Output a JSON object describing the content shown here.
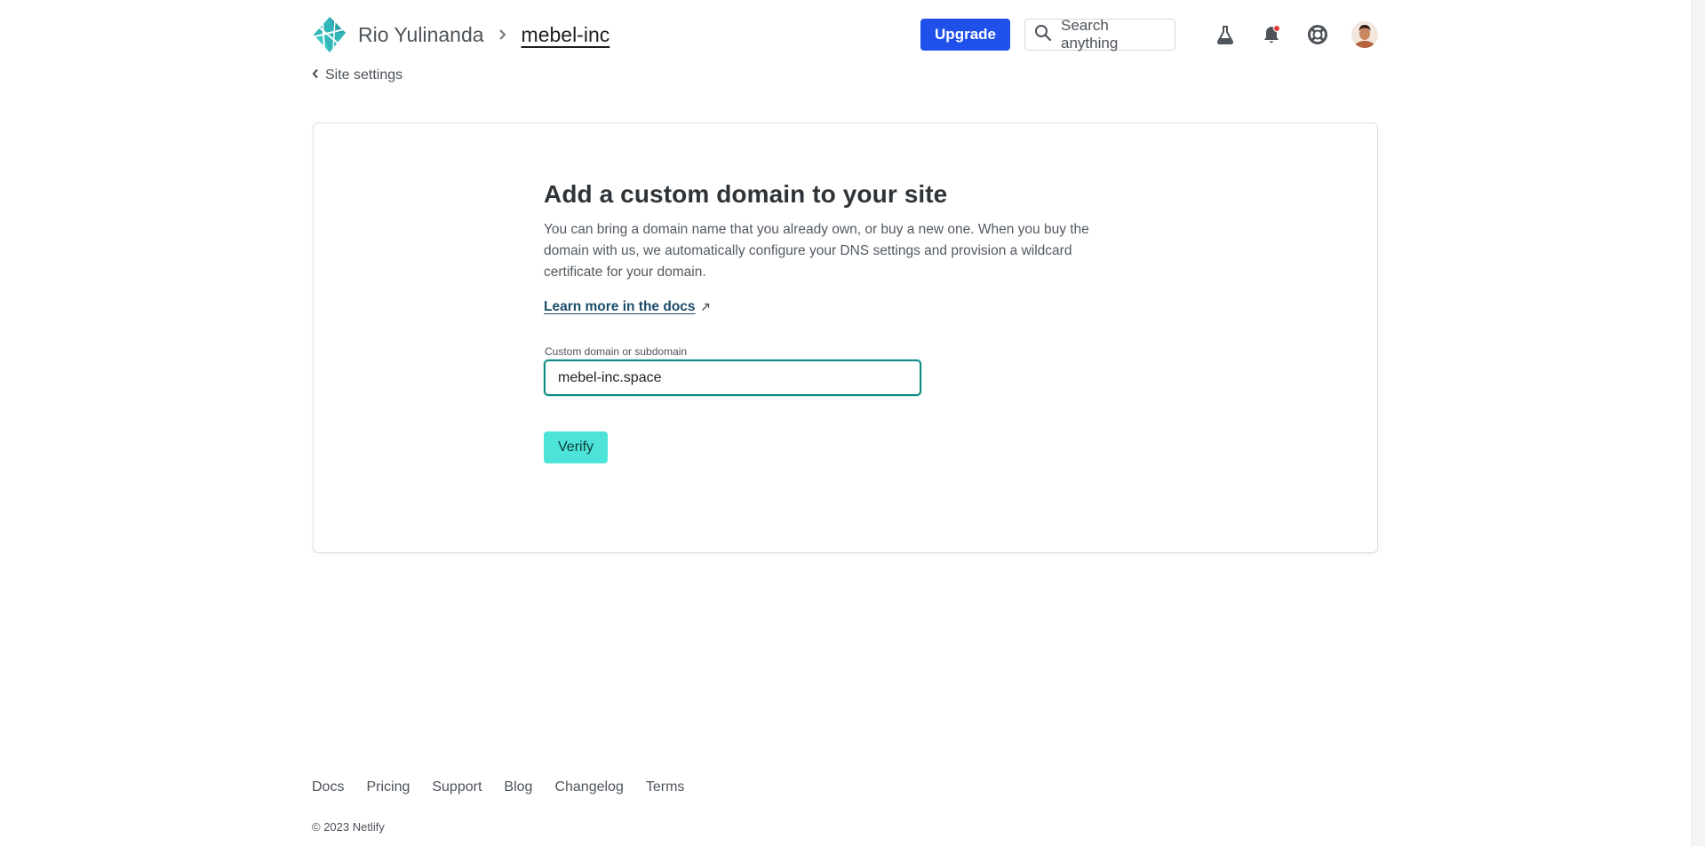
{
  "colors": {
    "primary_blue": "#1f51ea",
    "accent_teal": "#4de3d8",
    "input_border_focus": "#0f8a84",
    "link_color": "#1b4d6b",
    "notification_dot": "#e83a3a"
  },
  "header": {
    "logo_icon": "netlify-logo-icon",
    "breadcrumb": {
      "team": "Rio Yulinanda",
      "separator_icon": "chevron-right-icon",
      "site": "mebel-inc"
    },
    "upgrade_label": "Upgrade",
    "search": {
      "icon": "search-icon",
      "placeholder": "Search anything"
    },
    "icons": [
      "flask-icon",
      "bell-icon",
      "lifebuoy-icon"
    ],
    "avatar": "user-avatar"
  },
  "back_link": {
    "icon": "chevron-left-icon",
    "label": "Site settings"
  },
  "card": {
    "title": "Add a custom domain to your site",
    "description": "You can bring a domain name that you already own, or buy a new one. When you buy the domain with us, we automatically configure your DNS settings and provision a wildcard certificate for your domain.",
    "docs_link": "Learn more in the docs",
    "docs_link_icon": "external-arrow-icon",
    "field_label": "Custom domain or subdomain",
    "field_value": "mebel-inc.space",
    "verify_label": "Verify"
  },
  "footer": {
    "links": [
      "Docs",
      "Pricing",
      "Support",
      "Blog",
      "Changelog",
      "Terms"
    ],
    "copyright": "© 2023 Netlify"
  }
}
